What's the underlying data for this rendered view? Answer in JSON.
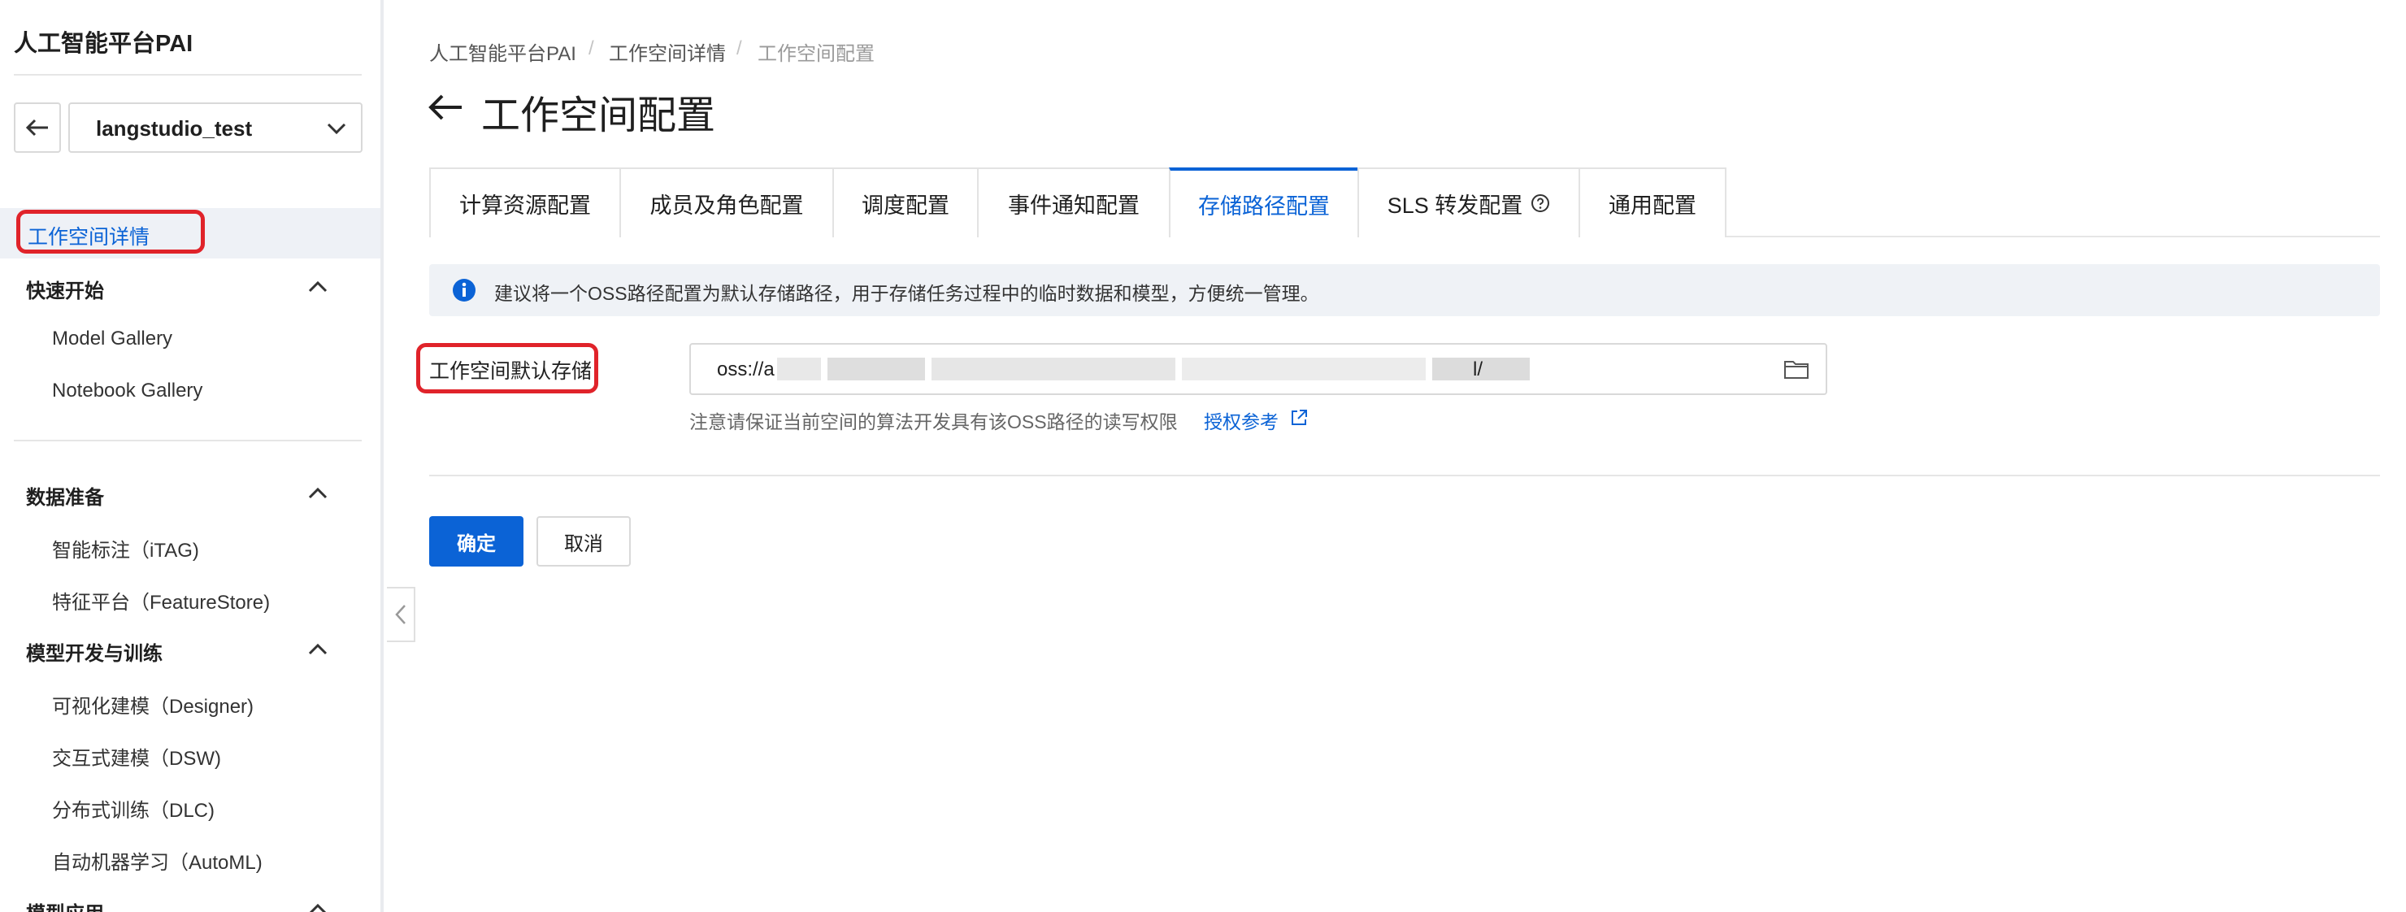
{
  "sidebar": {
    "app_title": "人工智能平台PAI",
    "workspace_name": "langstudio_test",
    "active_item": "工作空间详情",
    "groups": [
      {
        "label": "快速开始",
        "items": [
          "Model Gallery",
          "Notebook Gallery"
        ]
      },
      {
        "label": "数据准备",
        "items": [
          "智能标注（iTAG)",
          "特征平台（FeatureStore)"
        ]
      },
      {
        "label": "模型开发与训练",
        "items": [
          "可视化建模（Designer)",
          "交互式建模（DSW)",
          "分布式训练（DLC)",
          "自动机器学习（AutoML)"
        ]
      },
      {
        "label": "模型应用",
        "items": []
      }
    ]
  },
  "breadcrumb": [
    "人工智能平台PAI",
    "工作空间详情",
    "工作空间配置"
  ],
  "page_title": "工作空间配置",
  "tabs": [
    "计算资源配置",
    "成员及角色配置",
    "调度配置",
    "事件通知配置",
    "存储路径配置",
    "SLS 转发配置",
    "通用配置"
  ],
  "active_tab": "存储路径配置",
  "info_text": "建议将一个OSS路径配置为默认存储路径，用于存储任务过程中的临时数据和模型，方便统一管理。",
  "form": {
    "label": "工作空间默认存储",
    "value_prefix": "oss://a",
    "value_suffix": "l/",
    "hint": "注意请保证当前空间的算法开发具有该OSS路径的读写权限",
    "hint_link": "授权参考"
  },
  "buttons": {
    "confirm": "确定",
    "cancel": "取消"
  },
  "colors": {
    "primary": "#0b63d6",
    "highlight_box": "#e0232a",
    "info_bg": "#eff2f6"
  }
}
